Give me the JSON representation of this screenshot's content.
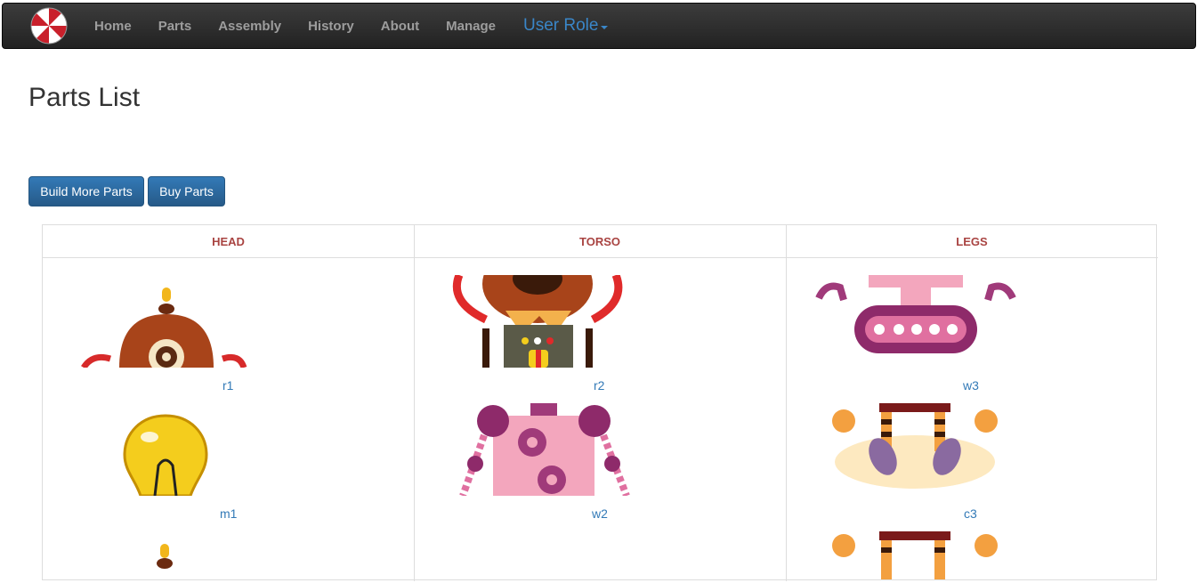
{
  "nav": {
    "items": [
      "Home",
      "Parts",
      "Assembly",
      "History",
      "About",
      "Manage"
    ],
    "role_label": "User Role"
  },
  "page": {
    "title": "Parts List"
  },
  "actions": {
    "build_label": "Build More Parts",
    "buy_label": "Buy Parts"
  },
  "table": {
    "headers": [
      "HEAD",
      "TORSO",
      "LEGS"
    ],
    "rows": [
      [
        "r1",
        "r2",
        "w3"
      ],
      [
        "m1",
        "w2",
        "c3"
      ]
    ]
  },
  "colors": {
    "accent": "#337ab7",
    "header_text": "#a94442",
    "navbar": "#222222"
  }
}
